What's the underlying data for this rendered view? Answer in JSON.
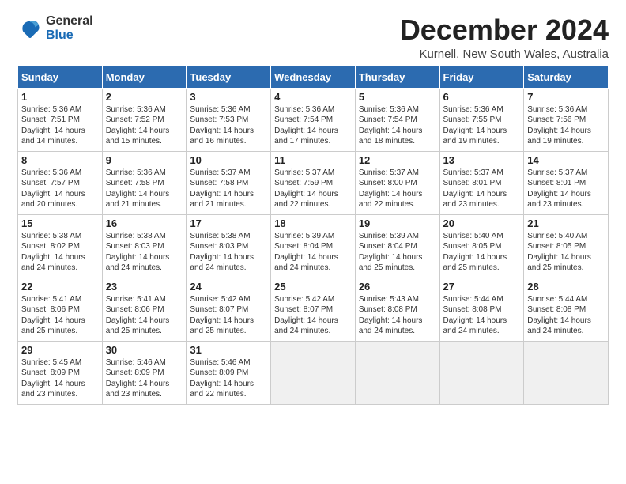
{
  "logo": {
    "general": "General",
    "blue": "Blue"
  },
  "title": "December 2024",
  "location": "Kurnell, New South Wales, Australia",
  "days_of_week": [
    "Sunday",
    "Monday",
    "Tuesday",
    "Wednesday",
    "Thursday",
    "Friday",
    "Saturday"
  ],
  "weeks": [
    [
      {
        "day": "1",
        "info": "Sunrise: 5:36 AM\nSunset: 7:51 PM\nDaylight: 14 hours\nand 14 minutes."
      },
      {
        "day": "2",
        "info": "Sunrise: 5:36 AM\nSunset: 7:52 PM\nDaylight: 14 hours\nand 15 minutes."
      },
      {
        "day": "3",
        "info": "Sunrise: 5:36 AM\nSunset: 7:53 PM\nDaylight: 14 hours\nand 16 minutes."
      },
      {
        "day": "4",
        "info": "Sunrise: 5:36 AM\nSunset: 7:54 PM\nDaylight: 14 hours\nand 17 minutes."
      },
      {
        "day": "5",
        "info": "Sunrise: 5:36 AM\nSunset: 7:54 PM\nDaylight: 14 hours\nand 18 minutes."
      },
      {
        "day": "6",
        "info": "Sunrise: 5:36 AM\nSunset: 7:55 PM\nDaylight: 14 hours\nand 19 minutes."
      },
      {
        "day": "7",
        "info": "Sunrise: 5:36 AM\nSunset: 7:56 PM\nDaylight: 14 hours\nand 19 minutes."
      }
    ],
    [
      {
        "day": "8",
        "info": "Sunrise: 5:36 AM\nSunset: 7:57 PM\nDaylight: 14 hours\nand 20 minutes."
      },
      {
        "day": "9",
        "info": "Sunrise: 5:36 AM\nSunset: 7:58 PM\nDaylight: 14 hours\nand 21 minutes."
      },
      {
        "day": "10",
        "info": "Sunrise: 5:37 AM\nSunset: 7:58 PM\nDaylight: 14 hours\nand 21 minutes."
      },
      {
        "day": "11",
        "info": "Sunrise: 5:37 AM\nSunset: 7:59 PM\nDaylight: 14 hours\nand 22 minutes."
      },
      {
        "day": "12",
        "info": "Sunrise: 5:37 AM\nSunset: 8:00 PM\nDaylight: 14 hours\nand 22 minutes."
      },
      {
        "day": "13",
        "info": "Sunrise: 5:37 AM\nSunset: 8:01 PM\nDaylight: 14 hours\nand 23 minutes."
      },
      {
        "day": "14",
        "info": "Sunrise: 5:37 AM\nSunset: 8:01 PM\nDaylight: 14 hours\nand 23 minutes."
      }
    ],
    [
      {
        "day": "15",
        "info": "Sunrise: 5:38 AM\nSunset: 8:02 PM\nDaylight: 14 hours\nand 24 minutes."
      },
      {
        "day": "16",
        "info": "Sunrise: 5:38 AM\nSunset: 8:03 PM\nDaylight: 14 hours\nand 24 minutes."
      },
      {
        "day": "17",
        "info": "Sunrise: 5:38 AM\nSunset: 8:03 PM\nDaylight: 14 hours\nand 24 minutes."
      },
      {
        "day": "18",
        "info": "Sunrise: 5:39 AM\nSunset: 8:04 PM\nDaylight: 14 hours\nand 24 minutes."
      },
      {
        "day": "19",
        "info": "Sunrise: 5:39 AM\nSunset: 8:04 PM\nDaylight: 14 hours\nand 25 minutes."
      },
      {
        "day": "20",
        "info": "Sunrise: 5:40 AM\nSunset: 8:05 PM\nDaylight: 14 hours\nand 25 minutes."
      },
      {
        "day": "21",
        "info": "Sunrise: 5:40 AM\nSunset: 8:05 PM\nDaylight: 14 hours\nand 25 minutes."
      }
    ],
    [
      {
        "day": "22",
        "info": "Sunrise: 5:41 AM\nSunset: 8:06 PM\nDaylight: 14 hours\nand 25 minutes."
      },
      {
        "day": "23",
        "info": "Sunrise: 5:41 AM\nSunset: 8:06 PM\nDaylight: 14 hours\nand 25 minutes."
      },
      {
        "day": "24",
        "info": "Sunrise: 5:42 AM\nSunset: 8:07 PM\nDaylight: 14 hours\nand 25 minutes."
      },
      {
        "day": "25",
        "info": "Sunrise: 5:42 AM\nSunset: 8:07 PM\nDaylight: 14 hours\nand 24 minutes."
      },
      {
        "day": "26",
        "info": "Sunrise: 5:43 AM\nSunset: 8:08 PM\nDaylight: 14 hours\nand 24 minutes."
      },
      {
        "day": "27",
        "info": "Sunrise: 5:44 AM\nSunset: 8:08 PM\nDaylight: 14 hours\nand 24 minutes."
      },
      {
        "day": "28",
        "info": "Sunrise: 5:44 AM\nSunset: 8:08 PM\nDaylight: 14 hours\nand 24 minutes."
      }
    ],
    [
      {
        "day": "29",
        "info": "Sunrise: 5:45 AM\nSunset: 8:09 PM\nDaylight: 14 hours\nand 23 minutes."
      },
      {
        "day": "30",
        "info": "Sunrise: 5:46 AM\nSunset: 8:09 PM\nDaylight: 14 hours\nand 23 minutes."
      },
      {
        "day": "31",
        "info": "Sunrise: 5:46 AM\nSunset: 8:09 PM\nDaylight: 14 hours\nand 22 minutes."
      },
      {
        "day": "",
        "info": ""
      },
      {
        "day": "",
        "info": ""
      },
      {
        "day": "",
        "info": ""
      },
      {
        "day": "",
        "info": ""
      }
    ]
  ]
}
